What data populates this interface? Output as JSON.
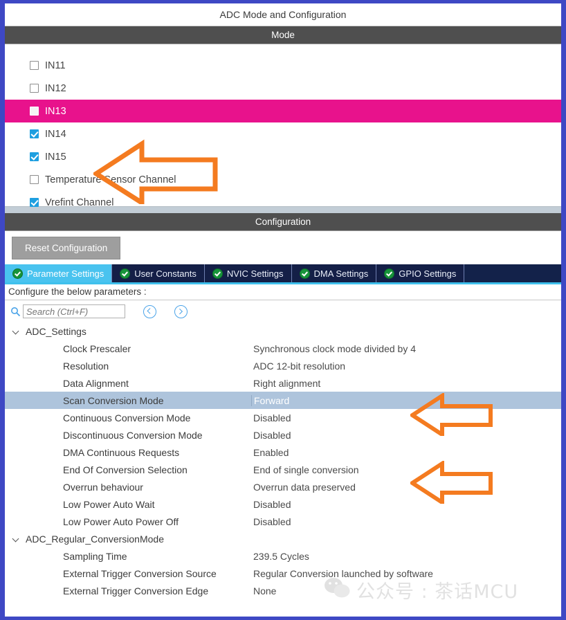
{
  "window": {
    "title": "ADC Mode and Configuration",
    "border_color": "#3e48c4"
  },
  "mode_section": {
    "header": "Mode",
    "channels": [
      {
        "label": "IN11",
        "checked": false,
        "highlighted": false
      },
      {
        "label": "IN12",
        "checked": false,
        "highlighted": false
      },
      {
        "label": "IN13",
        "checked": false,
        "highlighted": true
      },
      {
        "label": "IN14",
        "checked": true,
        "highlighted": false
      },
      {
        "label": "IN15",
        "checked": true,
        "highlighted": false
      },
      {
        "label": "Temperature Sensor Channel",
        "checked": false,
        "highlighted": false
      },
      {
        "label": "Vrefint Channel",
        "checked": true,
        "highlighted": false
      }
    ],
    "highlight_color": "#e8128c",
    "checked_color": "#1e9fe0"
  },
  "configuration_section": {
    "header": "Configuration",
    "reset_button": "Reset Configuration",
    "tabs": [
      {
        "label": "Parameter Settings",
        "icon": "green-check-icon",
        "active": true
      },
      {
        "label": "User Constants",
        "icon": "green-check-icon",
        "active": false
      },
      {
        "label": "NVIC Settings",
        "icon": "green-check-icon",
        "active": false
      },
      {
        "label": "DMA Settings",
        "icon": "green-check-icon",
        "active": false
      },
      {
        "label": "GPIO Settings",
        "icon": "green-check-icon",
        "active": false
      }
    ],
    "active_tab_color": "#49c3ef",
    "configure_hint": "Configure the below parameters :",
    "search": {
      "placeholder": "Search (Ctrl+F)",
      "value": "",
      "icon": "search-icon",
      "prev_icon": "chevron-left-circle-icon",
      "next_icon": "chevron-right-circle-icon"
    }
  },
  "parameters": {
    "groups": [
      {
        "name": "ADC_Settings",
        "expanded": true,
        "rows": [
          {
            "name": "Clock Prescaler",
            "value": "Synchronous clock mode divided by 4",
            "selected": false
          },
          {
            "name": "Resolution",
            "value": "ADC 12-bit resolution",
            "selected": false
          },
          {
            "name": "Data Alignment",
            "value": "Right alignment",
            "selected": false
          },
          {
            "name": "Scan Conversion Mode",
            "value": "Forward",
            "selected": true
          },
          {
            "name": "Continuous Conversion Mode",
            "value": "Disabled",
            "selected": false
          },
          {
            "name": "Discontinuous Conversion Mode",
            "value": "Disabled",
            "selected": false
          },
          {
            "name": "DMA Continuous Requests",
            "value": "Enabled",
            "selected": false
          },
          {
            "name": "End Of Conversion Selection",
            "value": "End of single conversion",
            "selected": false
          },
          {
            "name": "Overrun behaviour",
            "value": "Overrun data preserved",
            "selected": false
          },
          {
            "name": "Low Power Auto Wait",
            "value": "Disabled",
            "selected": false
          },
          {
            "name": "Low Power Auto Power Off",
            "value": "Disabled",
            "selected": false
          }
        ]
      },
      {
        "name": "ADC_Regular_ConversionMode",
        "expanded": true,
        "rows": [
          {
            "name": "Sampling Time",
            "value": "239.5 Cycles",
            "selected": false
          },
          {
            "name": "External Trigger Conversion Source",
            "value": "Regular Conversion launched by software",
            "selected": false
          },
          {
            "name": "External Trigger Conversion Edge",
            "value": "None",
            "selected": false
          }
        ]
      }
    ],
    "selected_row_color": "#aec4dc"
  },
  "annotations": {
    "arrow_color": "#f47b20",
    "arrows": [
      {
        "name": "arrow-temperature-sensor-channel",
        "points_to": "Temperature Sensor Channel"
      },
      {
        "name": "arrow-scan-conversion-mode",
        "points_to": "Scan Conversion Mode"
      },
      {
        "name": "arrow-dma-continuous-requests",
        "points_to": "DMA Continuous Requests"
      }
    ]
  },
  "watermark": {
    "text": "公众号 : 茶话MCU",
    "icon": "wechat-logo-icon",
    "color": "#c9c9c9"
  }
}
